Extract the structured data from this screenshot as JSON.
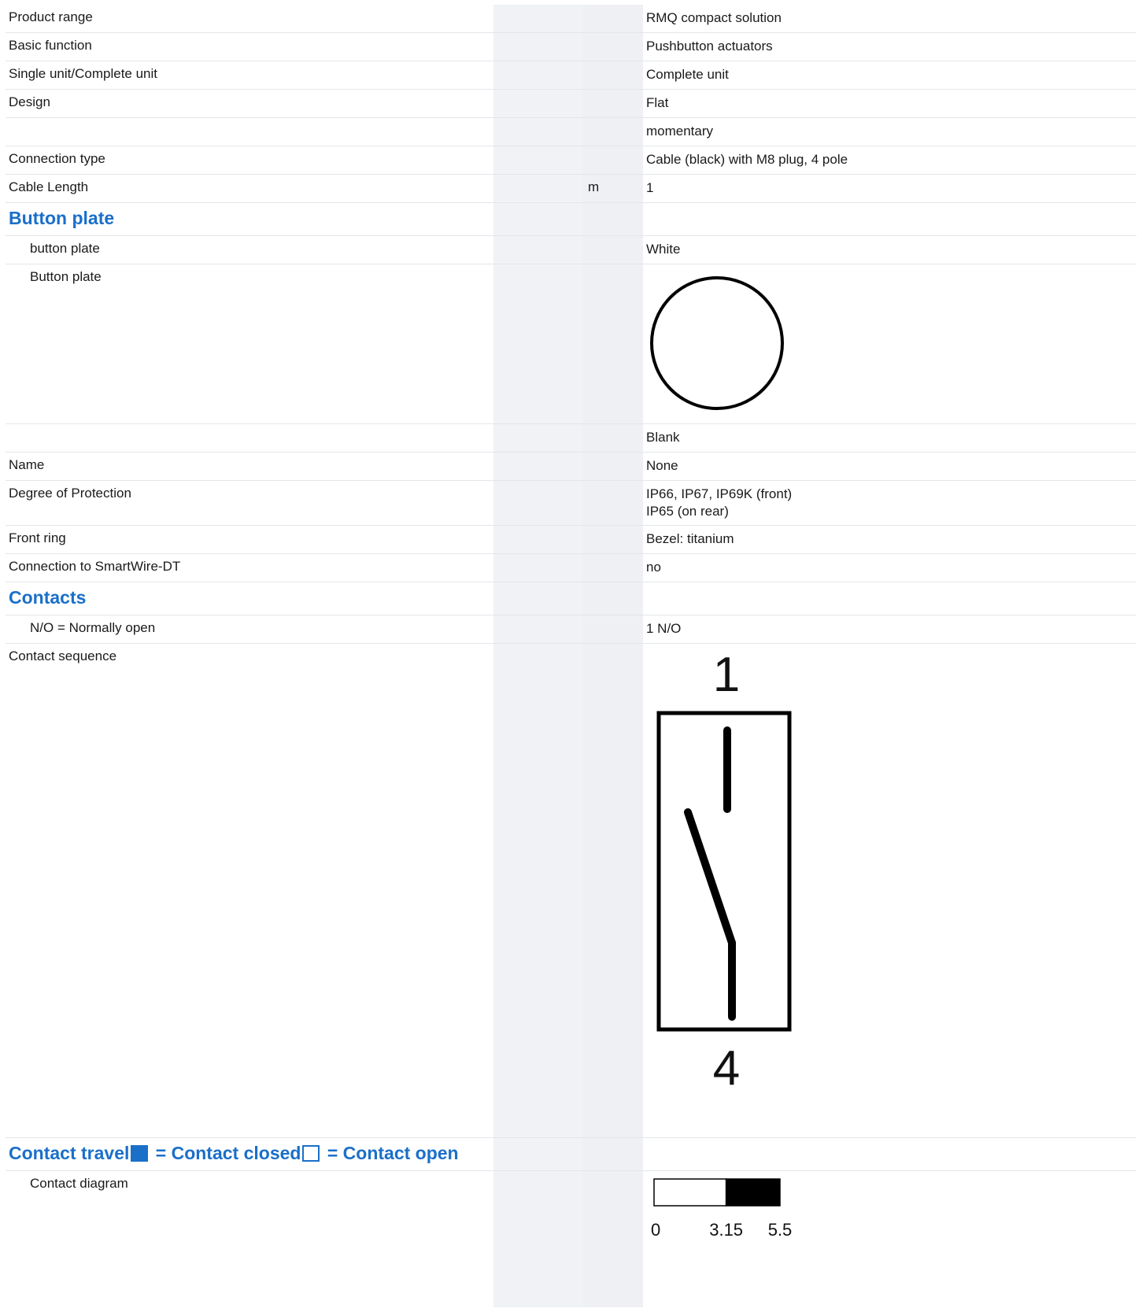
{
  "rows": {
    "product_range": {
      "label": "Product range",
      "value": "RMQ compact solution"
    },
    "basic_function": {
      "label": "Basic function",
      "value": "Pushbutton actuators"
    },
    "single_unit": {
      "label": "Single unit/Complete unit",
      "value": "Complete unit"
    },
    "design": {
      "label": "Design",
      "value": "Flat"
    },
    "design_extra": {
      "label": "",
      "value": "momentary"
    },
    "connection_type": {
      "label": "Connection type",
      "value": "Cable (black) with M8 plug, 4 pole"
    },
    "cable_length": {
      "label": "Cable Length",
      "unit": "m",
      "value": "1"
    }
  },
  "button_plate_section": {
    "title": "Button plate",
    "color_label": "button plate",
    "color_value": "White",
    "image_label": "Button plate",
    "blank_value": "Blank",
    "name_label": "Name",
    "name_value": "None",
    "protection_label": "Degree of Protection",
    "protection_line1": "IP66, IP67, IP69K (front)",
    "protection_line2": "IP65 (on rear)",
    "front_ring_label": "Front ring",
    "front_ring_value": "Bezel: titanium",
    "smartwire_label": "Connection to SmartWire-DT",
    "smartwire_value": "no"
  },
  "contacts_section": {
    "title": "Contacts",
    "no_label": "N/O = Normally open",
    "no_value": "1 N/O",
    "sequence_label": "Contact sequence",
    "terminal_top": "1",
    "terminal_bottom": "4"
  },
  "contact_travel": {
    "title_part1": "Contact travel",
    "title_part2": " = Contact closed",
    "title_part3": " = Contact open",
    "closed_color": "#1a6fc9",
    "diagram_label": "Contact diagram",
    "tick0": "0",
    "tick1": "3.15",
    "tick2": "5.5",
    "closed_from": 3.15,
    "travel_max": 5.5
  }
}
